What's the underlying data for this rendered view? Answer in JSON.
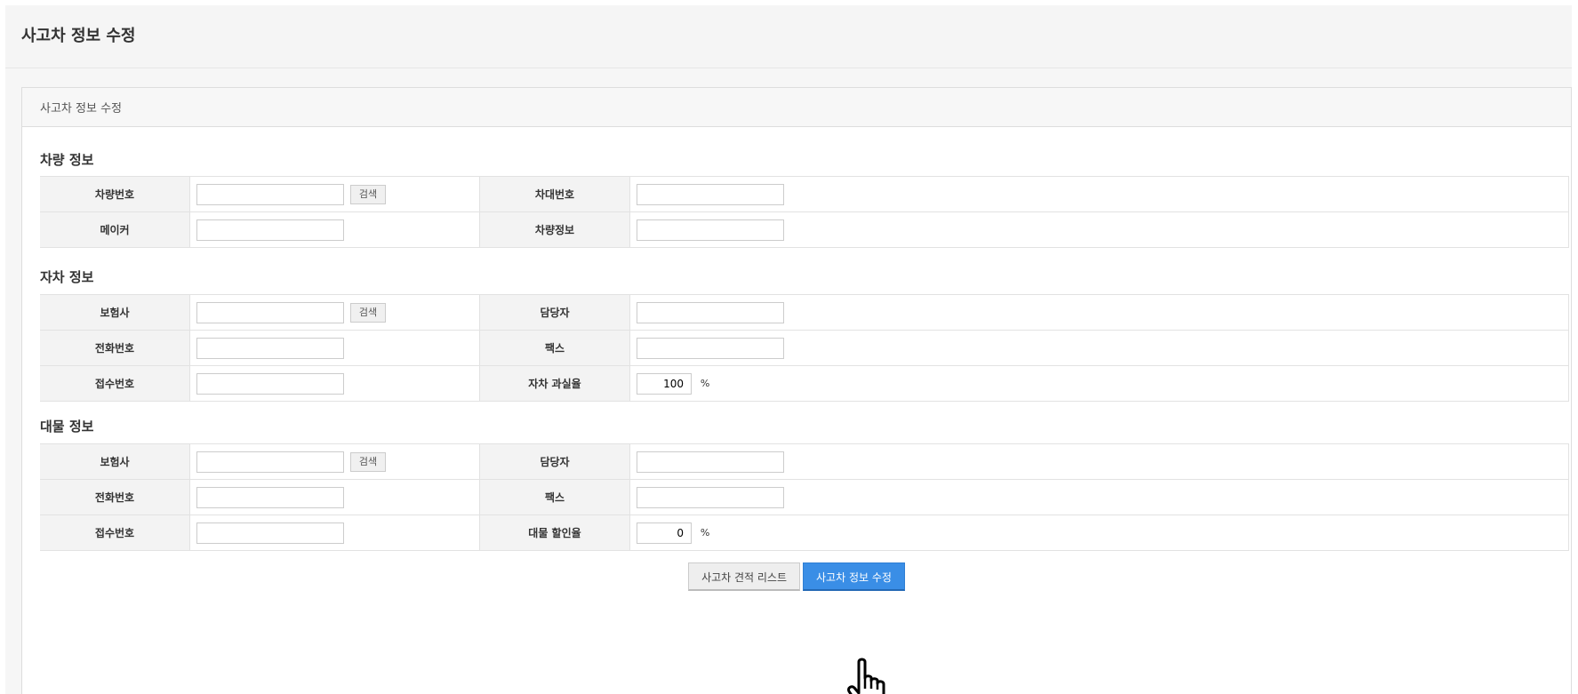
{
  "page": {
    "title": "사고차 정보 수정"
  },
  "panel": {
    "heading": "사고차 정보 수정"
  },
  "vehicle": {
    "title": "차량 정보",
    "rows": [
      {
        "label1": "차량번호",
        "search": "검색",
        "label2": "차대번호"
      },
      {
        "label1": "메이커",
        "label2": "차량정보"
      }
    ]
  },
  "own": {
    "title": "자차 정보",
    "rows": [
      {
        "label1": "보험사",
        "search": "검색",
        "label2": "담당자"
      },
      {
        "label1": "전화번호",
        "label2": "팩스"
      },
      {
        "label1": "접수번호",
        "label2": "자차 과실율",
        "value2": "100",
        "unit": "%"
      }
    ]
  },
  "property": {
    "title": "대물 정보",
    "rows": [
      {
        "label1": "보험사",
        "search": "검색",
        "label2": "담당자"
      },
      {
        "label1": "전화번호",
        "label2": "팩스"
      },
      {
        "label1": "접수번호",
        "label2": "대물 할인율",
        "value2": "0",
        "unit": "%"
      }
    ]
  },
  "buttons": {
    "list": "사고차 견적 리스트",
    "submit": "사고차 정보 수정"
  },
  "colors": {
    "primary": "#3a8ee6",
    "label_bg": "#f3f3f3",
    "page_bg": "#f6f6f6"
  },
  "icons": {
    "cursor": "hand-pointer-icon"
  }
}
